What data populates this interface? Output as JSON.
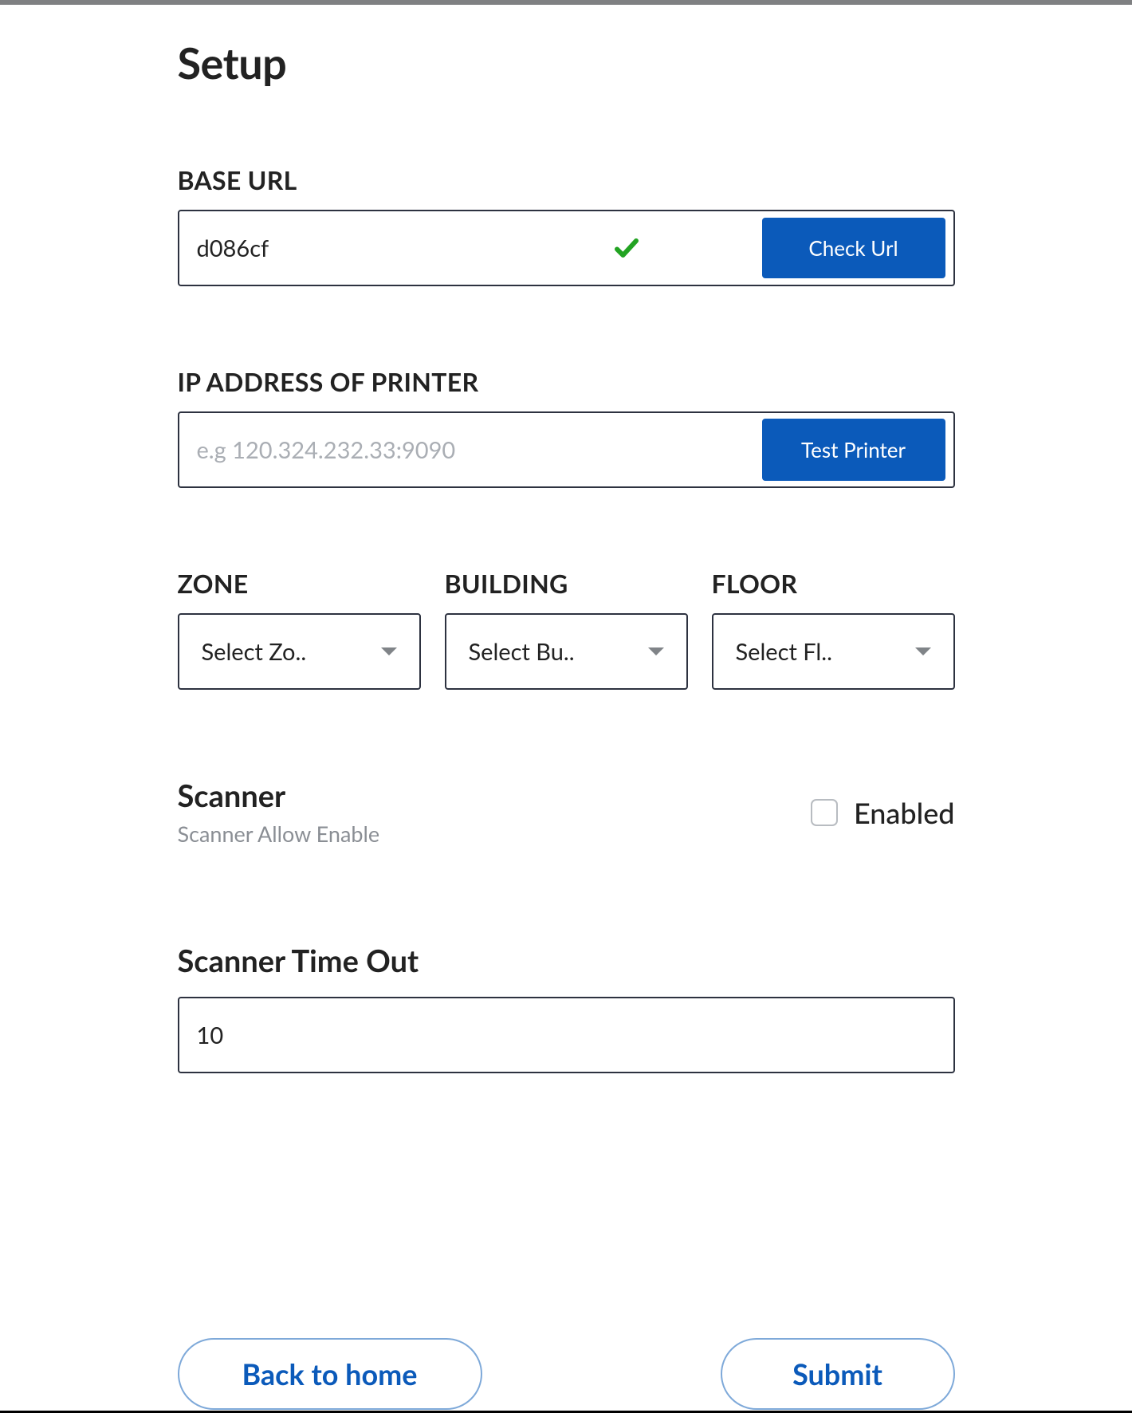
{
  "page_title": "Setup",
  "base_url": {
    "label": "BASE URL",
    "value": "d086cf",
    "button_label": "Check Url"
  },
  "printer_ip": {
    "label": "IP ADDRESS OF PRINTER",
    "placeholder": "e.g 120.324.232.33:9090",
    "button_label": "Test Printer"
  },
  "zone": {
    "label": "ZONE",
    "selected": "Select Zo.."
  },
  "building": {
    "label": "BUILDING",
    "selected": "Select Bu.."
  },
  "floor": {
    "label": "FLOOR",
    "selected": "Select Fl.."
  },
  "scanner": {
    "title": "Scanner",
    "subtitle": "Scanner Allow Enable",
    "enabled_label": "Enabled"
  },
  "timeout": {
    "label": "Scanner Time Out",
    "value": "10"
  },
  "buttons": {
    "back": "Back to home",
    "submit": "Submit"
  },
  "colors": {
    "primary": "#0b5aba",
    "check_green": "#1fa51f"
  }
}
